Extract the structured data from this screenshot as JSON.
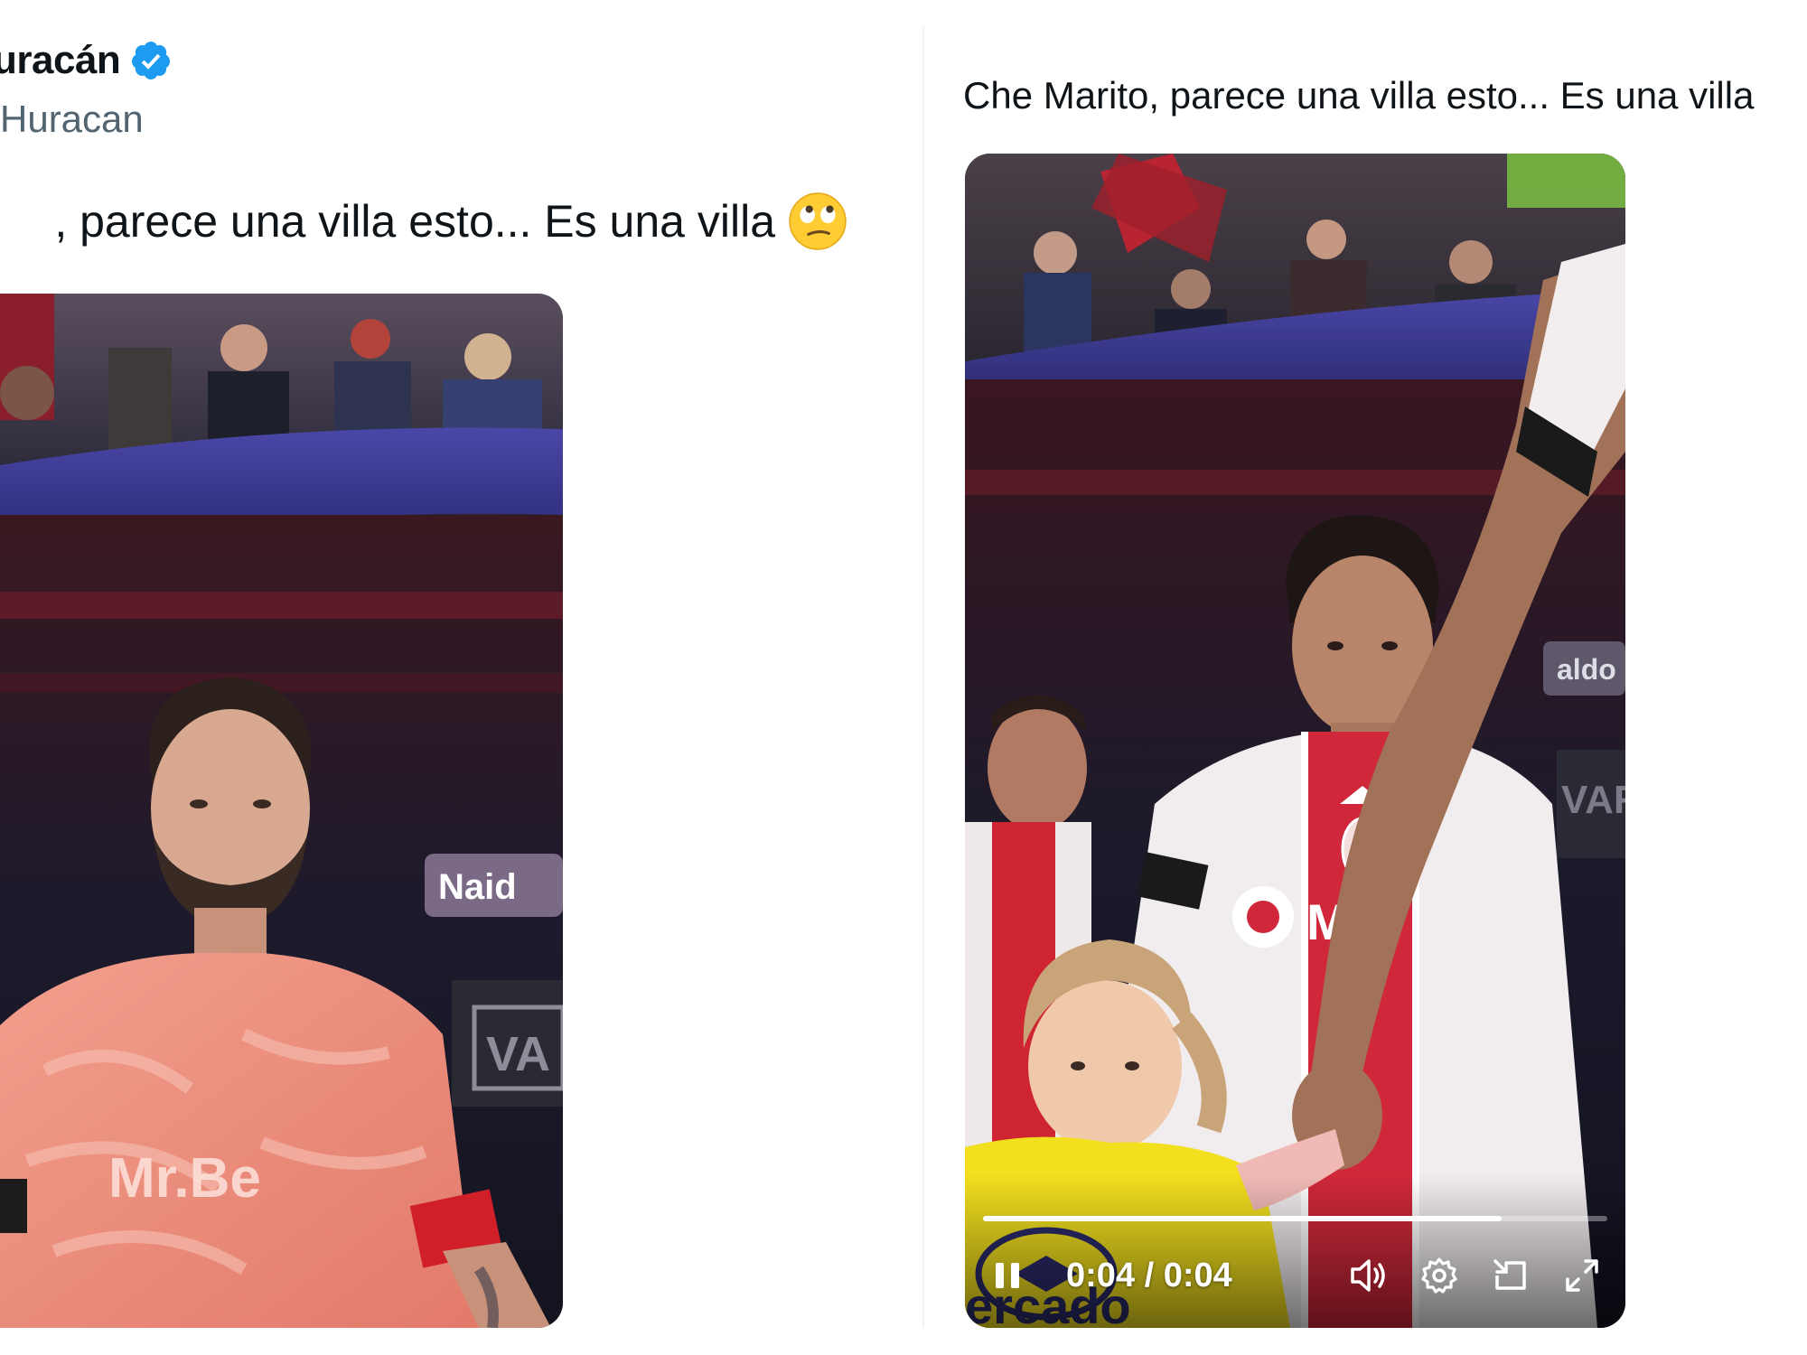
{
  "left_tweet": {
    "author_name": "uracán",
    "handle": "Huracan",
    "text": ", parece una villa esto... Es una villa",
    "emoji_icon": "face-with-rolling-eyes-icon",
    "verified_icon": "verified-badge-icon",
    "verified_color": "#1d9bf0",
    "video_overlay_text": [
      "Mr.Be",
      "Naid",
      "VA"
    ]
  },
  "right_tweet": {
    "text": "Che Marito, parece una villa esto... Es una villa",
    "video": {
      "overlay_text": [
        "Mr.",
        "aldo",
        "VAR",
        "ercado"
      ],
      "time": "0:04 / 0:04",
      "progress": 0.83,
      "controls": [
        "pause-icon",
        "volume-icon",
        "settings-icon",
        "pip-icon",
        "fullscreen-icon"
      ]
    }
  },
  "colors": {
    "text_primary": "#0f1419",
    "text_secondary": "#536471",
    "verified": "#1d9bf0"
  }
}
